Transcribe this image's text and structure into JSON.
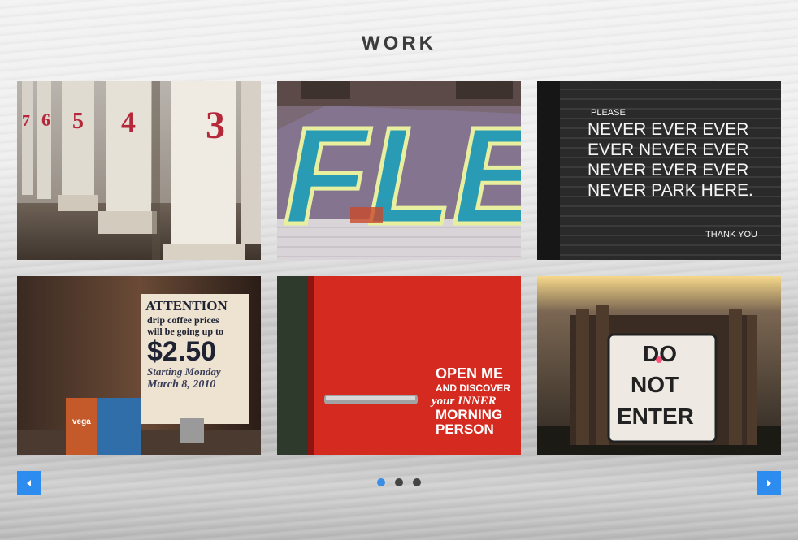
{
  "section_title": "WORK",
  "tiles": [
    {
      "name": "numbered-pillars",
      "labels": [
        "7",
        "6",
        "5",
        "4",
        "3"
      ]
    },
    {
      "name": "graffiti-wall",
      "text": "FLE"
    },
    {
      "name": "never-park-sign",
      "small_top": "PLEASE",
      "lines": [
        "NEVER EVER EVER",
        "EVER NEVER EVER",
        "NEVER EVER EVER",
        "NEVER PARK HERE."
      ],
      "small_bottom": "THANK YOU"
    },
    {
      "name": "attention-coffee-sign",
      "lines": [
        "ATTENTION",
        "drip coffee prices",
        "will be going up to",
        "$2.50",
        "Starting Monday",
        "March 8, 2010"
      ],
      "box_label": "vega"
    },
    {
      "name": "red-fridge",
      "lines": [
        "OPEN ME",
        "AND DISCOVER",
        "your INNER",
        "MORNING",
        "PERSON"
      ]
    },
    {
      "name": "do-not-enter-sign",
      "lines": [
        "DO",
        "NOT",
        "ENTER"
      ]
    }
  ],
  "pagination": {
    "pages": 3,
    "active_index": 0
  },
  "colors": {
    "accent": "#2d8cf0",
    "title": "#3c3c3c",
    "dot_inactive": "#444444",
    "dot_active": "#3a8ee6"
  },
  "icons": {
    "prev": "arrow-left-icon",
    "next": "arrow-right-icon"
  }
}
